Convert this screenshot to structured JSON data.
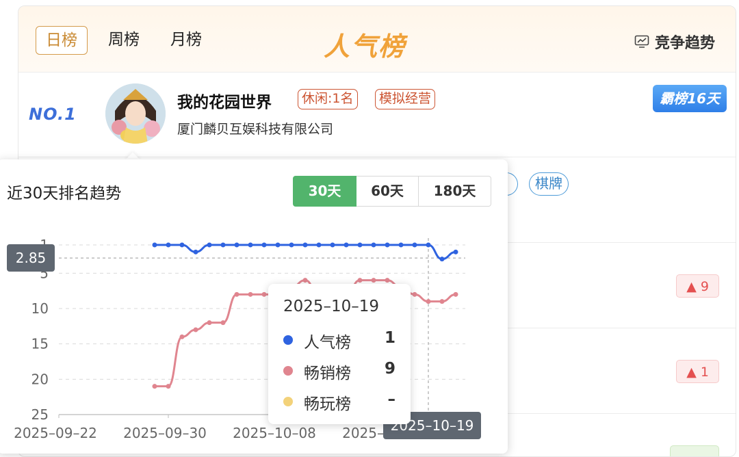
{
  "header": {
    "tabs": [
      "日榜",
      "周榜",
      "月榜"
    ],
    "active_tab": "日榜",
    "brand": "人气榜",
    "trend_link": "竞争趋势",
    "trend_icon": "chart-monitor-icon"
  },
  "rows": [
    {
      "rank": "NO.1",
      "name": "我的花园世界",
      "tags": [
        "休闲:1名",
        "模拟经营"
      ],
      "company": "厦门麟贝互娱科技有限公司",
      "badge": "霸榜16天"
    },
    {
      "tags": [
        "棋牌"
      ]
    },
    {
      "delta": "▲ 9"
    },
    {
      "delta": "▲ 1"
    }
  ],
  "popup": {
    "title": "近30天排名趋势",
    "ranges": [
      "30天",
      "60天",
      "180天"
    ],
    "active_range": "30天"
  },
  "crosshair": {
    "y_readout": "2.85",
    "x_readout": "2025–10–19"
  },
  "tooltip": {
    "date": "2025–10–19",
    "items": [
      {
        "name": "人气榜",
        "value": "1",
        "color": "#2f63e0"
      },
      {
        "name": "畅销榜",
        "value": "9",
        "color": "#e0858f"
      },
      {
        "name": "畅玩榜",
        "value": "–",
        "color": "#f3d27a"
      }
    ]
  },
  "colors": {
    "accent_orange": "#f0a23a",
    "rank_blue": "#3d6fd9",
    "green_active": "#52b46c",
    "delta_red": "#e45050"
  },
  "chart_data": {
    "type": "line",
    "title": "近30天排名趋势",
    "x_ticks": [
      "2025–09–22",
      "2025–09–30",
      "2025–10–08",
      "2025–10–16"
    ],
    "y_ticks": [
      1,
      5,
      10,
      15,
      20,
      25
    ],
    "ylim": [
      1,
      25
    ],
    "y_inverted": true,
    "grid": true,
    "x": [
      "2025–09–29",
      "2025–09–30",
      "2025–10–01",
      "2025–10–02",
      "2025–10–03",
      "2025–10–04",
      "2025–10–05",
      "2025–10–06",
      "2025–10–07",
      "2025–10–08",
      "2025–10–09",
      "2025–10–10",
      "2025–10–11",
      "2025–10–12",
      "2025–10–13",
      "2025–10–14",
      "2025–10–15",
      "2025–10–16",
      "2025–10–17",
      "2025–10–18",
      "2025–10–19",
      "2025–10–20",
      "2025–10–21"
    ],
    "series": [
      {
        "name": "人气榜",
        "color": "#2f63e0",
        "values": [
          1,
          1,
          1,
          2,
          1,
          1,
          1,
          1,
          1,
          1,
          1,
          1,
          1,
          1,
          1,
          1,
          1,
          1,
          1,
          1,
          1,
          3,
          2
        ]
      },
      {
        "name": "畅销榜",
        "color": "#e0858f",
        "values": [
          21,
          21,
          14,
          13,
          12,
          12,
          8,
          8,
          8,
          8,
          7,
          6,
          8,
          8,
          8,
          6,
          6,
          6,
          7,
          8,
          9,
          9,
          8
        ]
      }
    ]
  }
}
